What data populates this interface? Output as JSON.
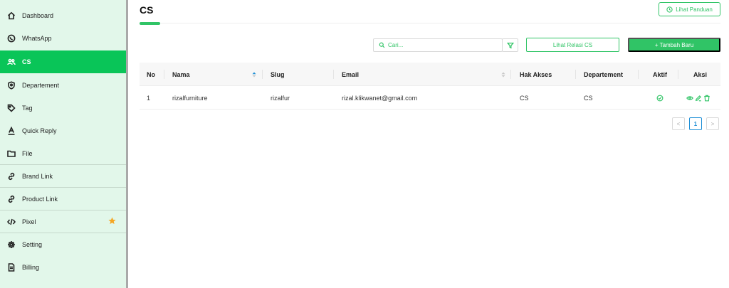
{
  "sidebar": {
    "items": [
      {
        "label": "Dashboard",
        "icon": "home-icon"
      },
      {
        "label": "WhatsApp",
        "icon": "whatsapp-icon"
      },
      {
        "label": "CS",
        "icon": "users-icon",
        "active": true
      },
      {
        "label": "Departement",
        "icon": "shield-icon"
      },
      {
        "label": "Tag",
        "icon": "tag-icon"
      },
      {
        "label": "Quick Reply",
        "icon": "underline-a-icon"
      },
      {
        "label": "File",
        "icon": "folder-icon"
      },
      {
        "label": "Brand Link",
        "icon": "link-icon"
      },
      {
        "label": "Product Link",
        "icon": "link-icon"
      },
      {
        "label": "Pixel",
        "icon": "code-icon",
        "badge_icon": "star-icon"
      },
      {
        "label": "Setting",
        "icon": "gear-icon"
      },
      {
        "label": "Billing",
        "icon": "document-icon"
      }
    ]
  },
  "header": {
    "title": "CS",
    "guide_label": "Lihat Panduan"
  },
  "toolbar": {
    "search_placeholder": "Cari...",
    "relasi_label": "Lihat Relasi CS",
    "add_label": "+ Tambah Baru"
  },
  "table": {
    "columns": [
      "No",
      "Nama",
      "Slug",
      "Email",
      "Hak Akses",
      "Departement",
      "Aktif",
      "Aksi"
    ],
    "rows": [
      {
        "no": "1",
        "nama": "rizalfurniture",
        "slug": "rizalfur",
        "email": "rizal.klikwanet@gmail.com",
        "hak_akses": "CS",
        "departement": "CS",
        "aktif_icon": "check-circle-icon",
        "actions": [
          "eye-icon",
          "edit-icon",
          "trash-icon"
        ]
      }
    ]
  },
  "pagination": {
    "prev": "<",
    "current": "1",
    "next": ">"
  },
  "colors": {
    "accent": "#30c466",
    "active_sidebar": "#09c558",
    "sidebar_bg": "#e2f7ea",
    "star": "#f5a623",
    "delete": "#30c466",
    "pager_active": "#1e8fd6"
  }
}
